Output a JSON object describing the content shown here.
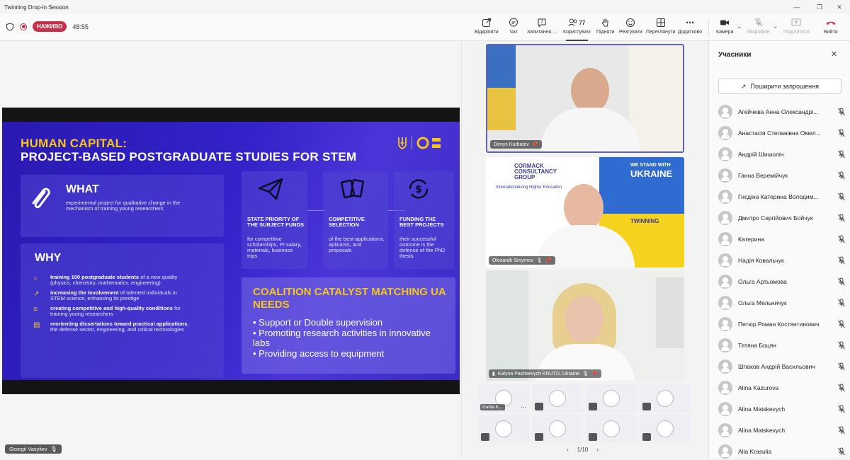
{
  "window": {
    "title": "Twinning Drop-in Session"
  },
  "meeting": {
    "live_label": "НАЖИВО",
    "elapsed": "48:55"
  },
  "toolbar": {
    "open": "Відкріпити",
    "chat": "Чат",
    "questions": "Запитання ...",
    "users": "Користувачі",
    "users_count": "77",
    "raise": "Підняти",
    "react": "Реагувати",
    "view": "Переглянути",
    "more": "Додатково",
    "camera": "Камера",
    "mic": "Мікрофон",
    "share": "Поділитися",
    "leave": "Вийти"
  },
  "slide": {
    "title_line1": "HUMAN CAPITAL:",
    "title_line2": "PROJECT-BASED POSTGRADUATE STUDIES FOR STEM",
    "what_heading": "WHAT",
    "what_text": "experimental project for qualitative change in the mechanism of training young researchers",
    "why_heading": "WHY",
    "why_items": [
      {
        "bold": "training 100 postgraduate students",
        "rest": " of a new quality (physics, chemistry, mathematics, engineering)"
      },
      {
        "bold": "increasing the involvement",
        "rest": " of talented individuals in STEM science, enhancing its prestige"
      },
      {
        "bold": "creating competitive and high-quality conditions",
        "rest": " for training young researchers"
      },
      {
        "bold": "reorienting dissertations toward practical applications",
        "rest": ", the defense sector, engineering, and critical technologies"
      }
    ],
    "steps": [
      {
        "title": "STATE PRIORITY OF THE SUBJECT FUNDS",
        "text": "for competitive scholarships, PI salary, materials, business trips"
      },
      {
        "title": "COMPETITIVE SELECTION",
        "text": "of the best applications, aplicants, and proposals"
      },
      {
        "title": "FUNDING THE BEST PROJECTS",
        "text": "their successful outcome is the defense of the PhD thesis"
      }
    ],
    "coalition_title": "COALITION CATALYST MATCHING UA NEEDS",
    "coalition_items": [
      "Support or Double supervision",
      "Promoting research activities in innovative labs",
      "Providing access to equipment"
    ]
  },
  "presenter": {
    "name": "Georgii Vasyliev"
  },
  "videos": [
    {
      "name": "Denys Kurbatov"
    },
    {
      "name": "Olexandr Smyrnov",
      "banner_org": "CORMACK CONSULTANCY GROUP",
      "banner_sub": "Internationalising Higher Education",
      "banner_stand": "WE STAND WITH",
      "banner_ukraine": "UKRAINE",
      "banner_twinning": "TWINNING"
    },
    {
      "name": "Kalyna Pashkevych KNUTD, Ukraine"
    }
  ],
  "thumb_first_name": "Dariia K...",
  "pager": "1/10",
  "panel": {
    "title": "Учасники",
    "invite_button": "Поширити запрошення",
    "participants": [
      "Агейчева Анна Олександрі...",
      "Анастасія Степанівна Омел...",
      "Андрій Шишолін",
      "Ганна Веремійчук",
      "Гнєдіна Катерина Володим...",
      "Дмитро Сергійович Бойчук",
      "Катерина",
      "Надія Ковальчук",
      "Ольга Артьомова",
      "Ольга Мельничук",
      "Петюр Роман Костянтинович",
      "Тетяна Боцян",
      "Шпаков Андрій Васильович",
      "Alina Kazurova",
      "Alina Matskevych",
      "Alina Matskevych",
      "Alla Krasulia"
    ]
  },
  "colors": {
    "live": "#c4314b",
    "slide_bg": "#3322c8",
    "accent_yellow": "#f5c518"
  }
}
